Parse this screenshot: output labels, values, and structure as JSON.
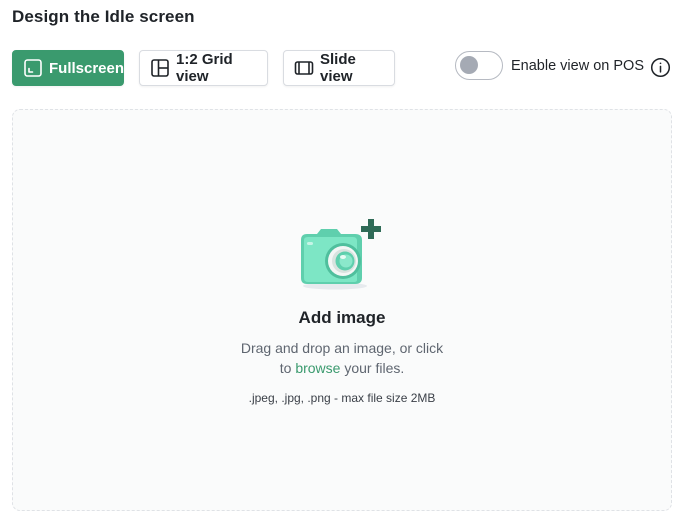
{
  "page": {
    "title": "Design the Idle screen"
  },
  "view_options": [
    {
      "label": "Fullscreen",
      "icon": "fullscreen-icon",
      "active": true
    },
    {
      "label": "1:2 Grid view",
      "icon": "grid-layout-icon",
      "active": false
    },
    {
      "label": "Slide view",
      "icon": "slide-view-icon",
      "active": false
    }
  ],
  "pos_toggle": {
    "label": "Enable view on POS",
    "enabled": false,
    "info_icon": "info-icon"
  },
  "upload": {
    "title": "Add image",
    "line1": "Drag and drop an image, or click",
    "line2_prefix": "to ",
    "browse_label": "browse",
    "line2_suffix": " your files.",
    "hint": ".jpeg, .jpg, .png - max file size 2MB",
    "illustration": "camera-add-icon"
  },
  "colors": {
    "accent": "#3a9a6e",
    "camera_body": "#6fe0be",
    "plus_badge": "#2f6b57",
    "toggle_knob": "#a5aab4"
  }
}
